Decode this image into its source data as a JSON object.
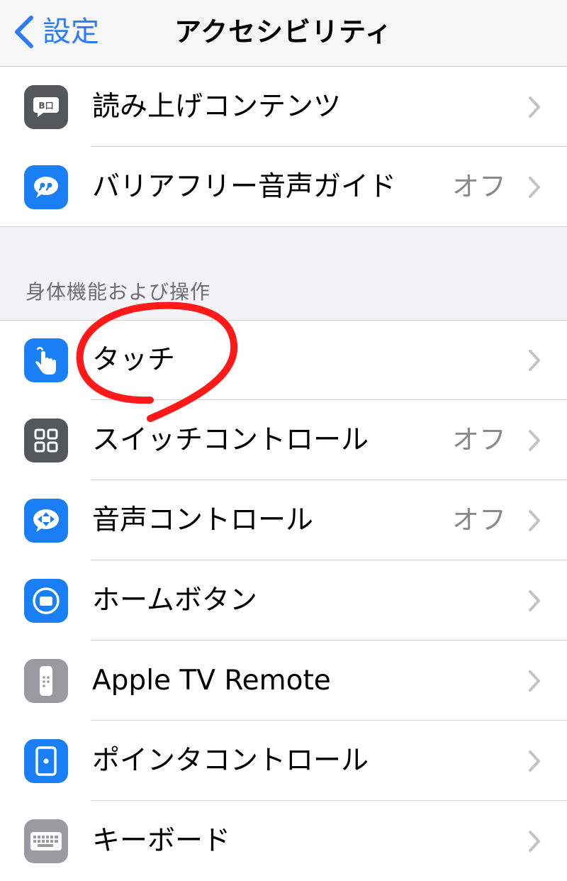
{
  "nav": {
    "back_label": "設定",
    "title": "アクセシビリティ"
  },
  "top_group": [
    {
      "label": "読み上げコンテンツ",
      "value": "",
      "icon": "speech-bubble-icon"
    },
    {
      "label": "バリアフリー音声ガイド",
      "value": "オフ",
      "icon": "quote-bubble-icon"
    }
  ],
  "section": {
    "header": "身体機能および操作",
    "items": [
      {
        "label": "タッチ",
        "value": "",
        "icon": "hand-touch-icon"
      },
      {
        "label": "スイッチコントロール",
        "value": "オフ",
        "icon": "switch-grid-icon"
      },
      {
        "label": "音声コントロール",
        "value": "オフ",
        "icon": "voice-control-icon"
      },
      {
        "label": "ホームボタン",
        "value": "",
        "icon": "home-button-icon"
      },
      {
        "label": "Apple TV Remote",
        "value": "",
        "icon": "tv-remote-icon"
      },
      {
        "label": "ポインタコントロール",
        "value": "",
        "icon": "pointer-icon"
      },
      {
        "label": "キーボード",
        "value": "",
        "icon": "keyboard-icon"
      }
    ]
  },
  "colors": {
    "accent": "#2f7bf6",
    "icon_blue": "#1a7ef4",
    "icon_gray": "#55575b",
    "annotation_red": "#ff1a1a"
  }
}
